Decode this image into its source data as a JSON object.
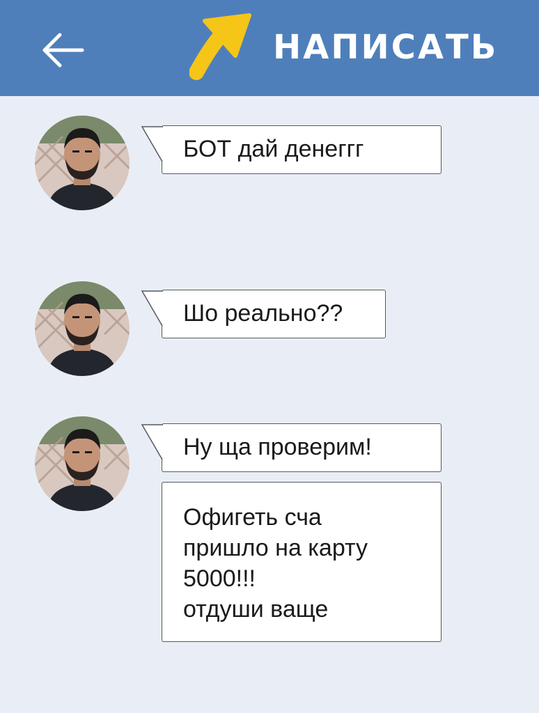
{
  "header": {
    "back_icon": "left-arrow-icon",
    "highlight_icon": "yellow-arrow-icon",
    "compose_label": "НАПИСАТЬ",
    "bg_color": "#4f7fba",
    "arrow_color": "#f5c518"
  },
  "messages": [
    {
      "text": "БОТ дай денеггг"
    },
    {
      "text": "Шо реально??"
    },
    {
      "text": "Ну ща проверим!"
    },
    {
      "text": "Офигеть сча\nпришло на карту\n5000!!!\nотдуши ваще"
    }
  ],
  "avatar": {
    "icon": "user-avatar"
  },
  "colors": {
    "chat_bg": "#e9eef6",
    "bubble_bg": "#ffffff",
    "bubble_border": "#555a60"
  }
}
